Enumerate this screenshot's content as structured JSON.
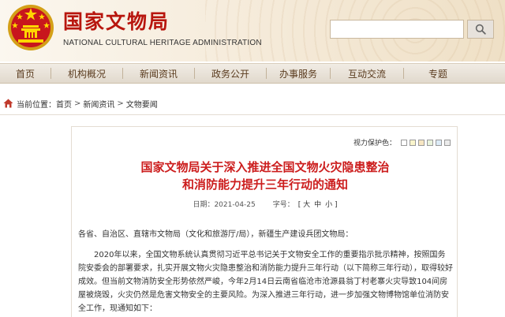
{
  "header": {
    "title": "国家文物局",
    "subtitle": "NATIONAL CULTURAL HERITAGE ADMINISTRATION",
    "search_placeholder": "",
    "brand_color": "#b8160e"
  },
  "nav": {
    "items": [
      {
        "label": "首页"
      },
      {
        "label": "机构概况"
      },
      {
        "label": "新闻资讯"
      },
      {
        "label": "政务公开"
      },
      {
        "label": "办事服务"
      },
      {
        "label": "互动交流"
      },
      {
        "label": "专题"
      }
    ]
  },
  "breadcrumb": {
    "prefix": "当前位置：",
    "items": [
      "首页",
      "新闻资讯",
      "文物要闻"
    ],
    "separator": ">"
  },
  "article": {
    "eye_protection_label": "视力保护色：",
    "eye_colors": [
      "#ffffff",
      "#faf5cc",
      "#f7e6c2",
      "#e9f3dc",
      "#dcebf7",
      "#ebebeb"
    ],
    "title_line1": "国家文物局关于深入推进全国文物火灾隐患整治",
    "title_line2": "和消防能力提升三年行动的通知",
    "date_label": "日期：2021-04-25",
    "font_size_label": "字号：",
    "font_size_big": "[ 大",
    "font_size_mid": "中",
    "font_size_small": "小 ]",
    "salutation": "各省、自治区、直辖市文物局（文化和旅游厅/局），新疆生产建设兵团文物局：",
    "paragraph": "2020年以来，全国文物系统认真贯彻习近平总书记关于文物安全工作的重要指示批示精神，按照国务院安委会的部署要求，扎实开展文物火灾隐患整治和消防能力提升三年行动（以下简称三年行动），取得较好成效。但当前文物消防安全形势依然严峻，今年2月14日云南省临沧市沧源县翁丁村老寨火灾导致104间房屋被烧毁，火灾仍然是危害文物安全的主要风险。为深入推进三年行动，进一步加强文物博物馆单位消防安全工作，现通知如下："
  }
}
